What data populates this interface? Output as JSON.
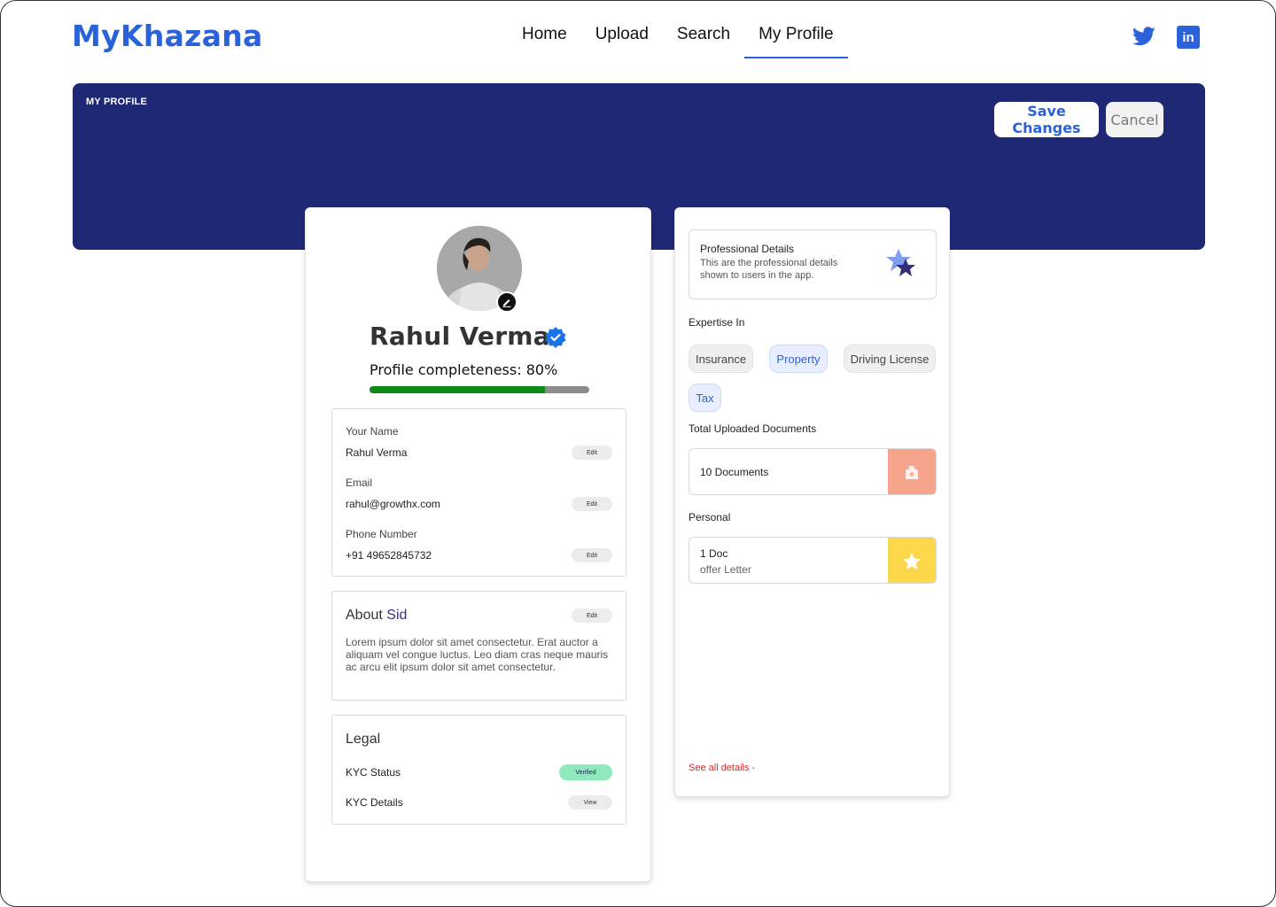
{
  "header": {
    "logo": "MyKhazana",
    "nav": [
      {
        "label": "Home"
      },
      {
        "label": "Upload"
      },
      {
        "label": "Search"
      },
      {
        "label": "My Profile",
        "active": true
      }
    ],
    "social": {
      "twitter_icon": "twitter-icon",
      "linkedin_label": "in"
    }
  },
  "banner": {
    "title": "MY PROFILE",
    "save_label": "Save Changes",
    "cancel_label": "Cancel"
  },
  "profile": {
    "name": "Rahul Verma",
    "completeness_text": "Profile completeness: 80%",
    "completeness_value": 0.8,
    "fields": [
      {
        "label": "Your Name",
        "value": "Rahul Verma",
        "action": "Edit"
      },
      {
        "label": "Email",
        "value": "rahul@growthx.com",
        "action": "Edit"
      },
      {
        "label": "Phone Number",
        "value": "+91 49652845732",
        "action": "Edit"
      }
    ],
    "about": {
      "title_prefix": "About ",
      "title_name": "Sid",
      "action": "Edit",
      "text": "Lorem ipsum dolor sit amet consectetur. Erat auctor a aliquam vel congue luctus. Leo diam cras neque mauris ac arcu elit ipsum dolor sit amet consectetur."
    },
    "legal": {
      "title": "Legal",
      "kyc_status_label": "KYC Status",
      "kyc_status_value": "Verified",
      "kyc_details_label": "KYC Details",
      "kyc_details_action": "View"
    }
  },
  "professional": {
    "title": "Professional Details",
    "description": "This are the professional details shown to users in the app.",
    "expertise_title": "Expertise In",
    "expertise": [
      "Insurance",
      "Property",
      "Driving License",
      "Tax"
    ],
    "uploaded_title": "Total Uploaded Documents",
    "uploaded_value": "10 Documents",
    "personal_title": "Personal",
    "personal_count": "1 Doc",
    "personal_name": "offer Letter",
    "see_all": "See all details -"
  },
  "colors": {
    "brand": "#2a63d9",
    "banner": "#1f2875",
    "progress": "#0c8a17",
    "uploaded_icon_bg": "#f6a48c",
    "personal_icon_bg": "#fcd74a",
    "link_red": "#d42c2c"
  }
}
